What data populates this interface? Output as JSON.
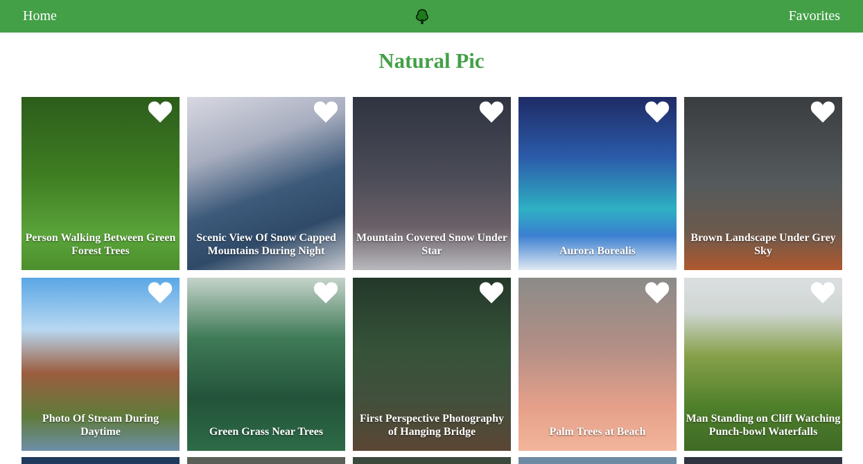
{
  "nav": {
    "home_label": "Home",
    "favorites_label": "Favorites",
    "logo_icon": "tree-icon"
  },
  "page_title": "Natural Pic",
  "colors": {
    "brand_green": "#43a047",
    "heart": "#ffffff"
  },
  "cards": [
    {
      "caption": "Person Walking Between Green Forest Trees",
      "icon": "heart-icon"
    },
    {
      "caption": "Scenic View Of Snow Capped Mountains During Night",
      "icon": "heart-icon"
    },
    {
      "caption": "Mountain Covered Snow Under Star",
      "icon": "heart-icon"
    },
    {
      "caption": "Aurora Borealis",
      "icon": "heart-icon"
    },
    {
      "caption": "Brown Landscape Under Grey Sky",
      "icon": "heart-icon"
    },
    {
      "caption": "Photo Of Stream During Daytime",
      "icon": "heart-icon"
    },
    {
      "caption": "Green Grass Near Trees",
      "icon": "heart-icon"
    },
    {
      "caption": "First Perspective Photography of Hanging Bridge",
      "icon": "heart-icon"
    },
    {
      "caption": "Palm Trees at Beach",
      "icon": "heart-icon"
    },
    {
      "caption": "Man Standing on Cliff Watching Punch-bowl Waterfalls",
      "icon": "heart-icon"
    }
  ]
}
